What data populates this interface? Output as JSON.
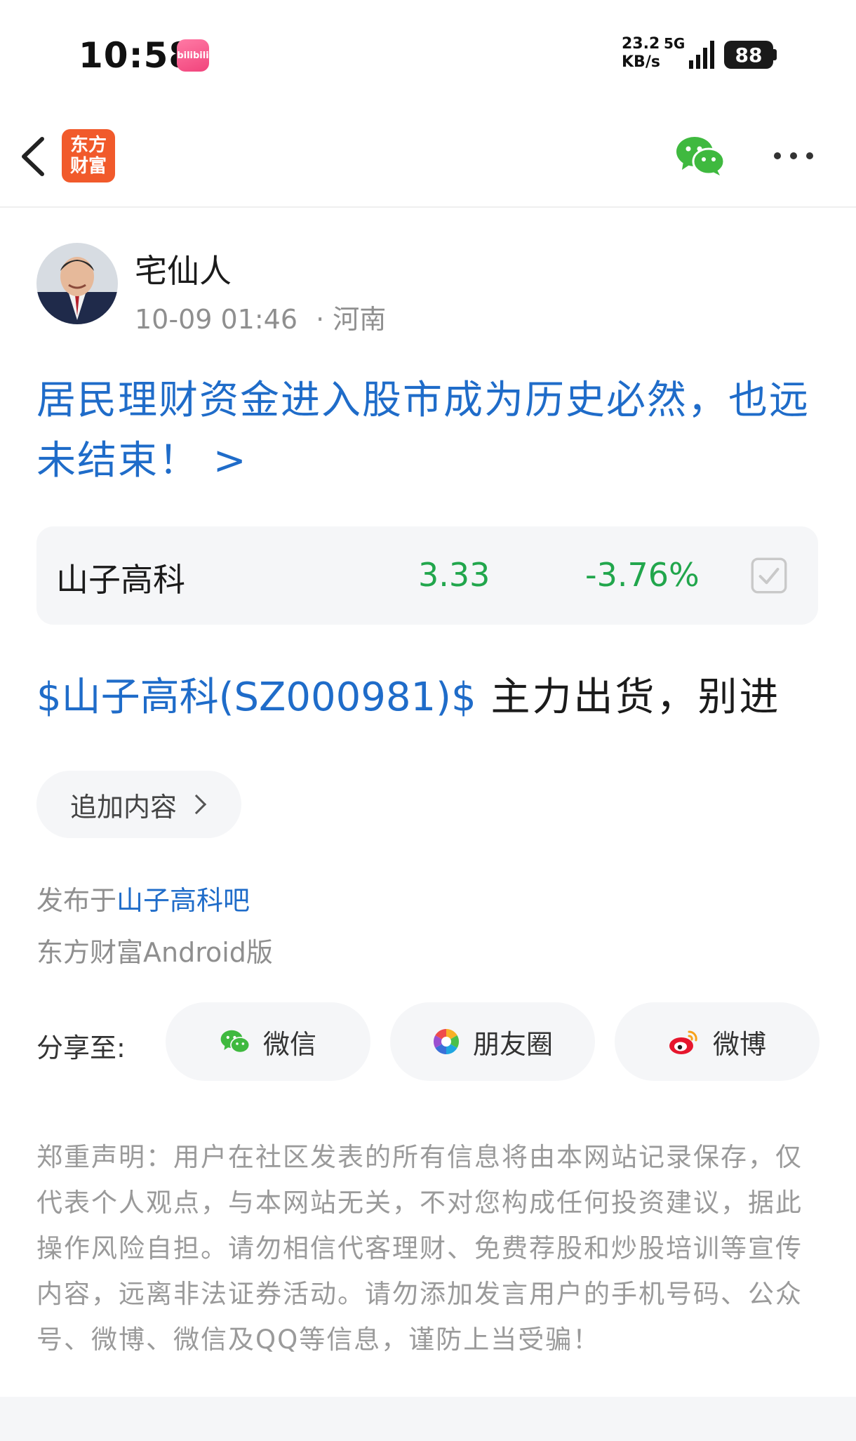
{
  "status_bar": {
    "time": "10:58",
    "app_badge": "bilibili",
    "net_speed_value": "23.2",
    "net_speed_unit": "KB/s",
    "network_type": "5G",
    "battery": "88"
  },
  "header": {
    "logo_line1": "东方",
    "logo_line2": "财富"
  },
  "author": {
    "name": "宅仙人",
    "datetime": "10-09 01:46",
    "location": "· 河南"
  },
  "post": {
    "title": "居民理财资金进入股市成为历史必然，也远未结束！ >",
    "body_link": "$山子高科(SZ000981)$",
    "body_text": " 主力出货，别进"
  },
  "stock": {
    "name": "山子高科",
    "price": "3.33",
    "change": "-3.76%"
  },
  "actions": {
    "add_content": "追加内容"
  },
  "meta": {
    "published_prefix": "发布于",
    "bar_name": "山子高科吧",
    "client": "东方财富Android版"
  },
  "share": {
    "label": "分享至:",
    "wechat": "微信",
    "moments": "朋友圈",
    "weibo": "微博"
  },
  "disclaimer": "郑重声明：用户在社区发表的所有信息将由本网站记录保存，仅代表个人观点，与本网站无关，不对您构成任何投资建议，据此操作风险自担。请勿相信代客理财、免费荐股和炒股培训等宣传内容，远离非法证券活动。请勿添加发言用户的手机号码、公众号、微博、微信及QQ等信息，谨防上当受骗！",
  "colors": {
    "link_blue": "#1f6cc9",
    "stock_green": "#21a64c",
    "brand_orange": "#f15a2b",
    "wechat_green": "#3fb93f"
  }
}
